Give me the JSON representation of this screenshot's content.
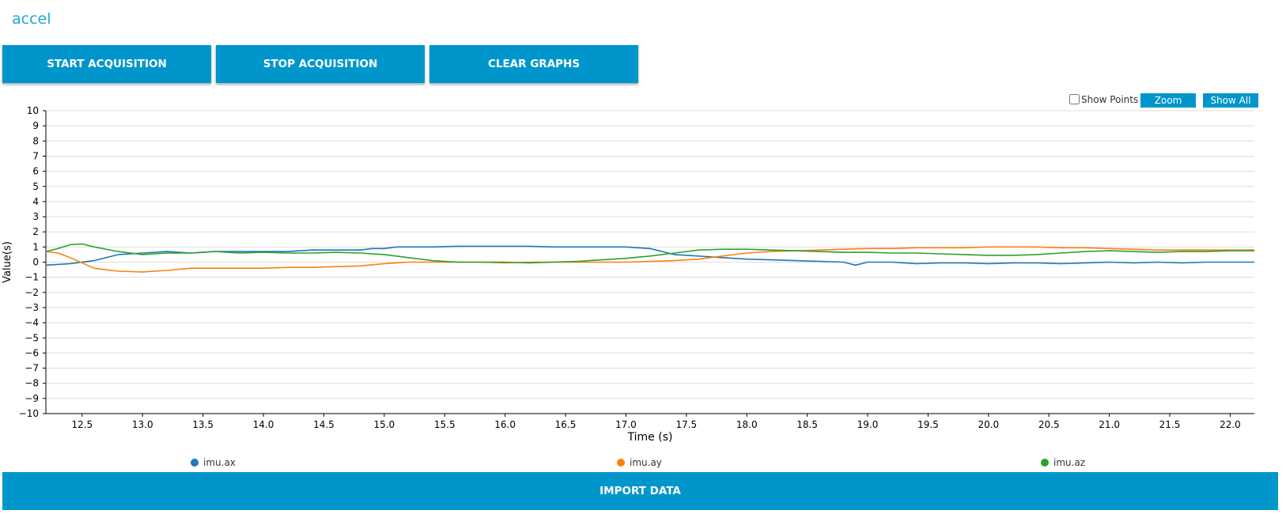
{
  "app": {
    "title": "accel"
  },
  "buttons": {
    "start": "START ACQUISITION",
    "stop": "STOP ACQUISITION",
    "clear": "CLEAR GRAPHS",
    "import": "IMPORT DATA",
    "color": "#0096cc"
  },
  "graph_controls": {
    "show_points_label": "Show Points",
    "show_points_checked": false,
    "zoom_label": "Zoom",
    "show_all_label": "Show All"
  },
  "chart_data": {
    "type": "line",
    "xlabel": "Time (s)",
    "ylabel": "Value(s)",
    "xlim": [
      12.2,
      22.2
    ],
    "ylim": [
      -10,
      10
    ],
    "xticks": [
      12.5,
      13.0,
      13.5,
      14.0,
      14.5,
      15.0,
      15.5,
      16.0,
      16.5,
      17.0,
      17.5,
      18.0,
      18.5,
      19.0,
      19.5,
      20.0,
      20.5,
      21.0,
      21.5,
      22.0
    ],
    "xtick_labels": [
      "12.5",
      "13.0",
      "13.5",
      "14.0",
      "14.5",
      "15.0",
      "15.5",
      "16.0",
      "16.5",
      "17.0",
      "17.5",
      "18.0",
      "18.5",
      "19.0",
      "19.5",
      "20.0",
      "20.5",
      "21.0",
      "21.5",
      "22.0"
    ],
    "yticks": [
      10,
      9,
      8,
      7,
      6,
      5,
      4,
      3,
      2,
      1,
      0,
      -1,
      -2,
      -3,
      -4,
      -5,
      -6,
      -7,
      -8,
      -9,
      -10
    ],
    "ytick_labels": [
      "10",
      "9",
      "8",
      "7",
      "6",
      "5",
      "4",
      "3",
      "2",
      "1",
      "0",
      "−1",
      "−2",
      "−3",
      "−4",
      "−5",
      "−6",
      "−7",
      "−8",
      "−9",
      "−10"
    ],
    "grid": true,
    "legend_position": "bottom",
    "series": [
      {
        "name": "imu.ax",
        "color": "#1f77b4",
        "x": [
          12.2,
          12.4,
          12.6,
          12.8,
          13.0,
          13.2,
          13.4,
          13.6,
          13.8,
          14.0,
          14.2,
          14.4,
          14.6,
          14.8,
          14.9,
          15.0,
          15.1,
          15.2,
          15.4,
          15.6,
          15.8,
          16.0,
          16.2,
          16.4,
          16.6,
          16.8,
          17.0,
          17.2,
          17.4,
          17.6,
          17.8,
          18.0,
          18.2,
          18.4,
          18.6,
          18.8,
          18.9,
          19.0,
          19.2,
          19.4,
          19.6,
          19.8,
          20.0,
          20.2,
          20.4,
          20.6,
          20.8,
          21.0,
          21.2,
          21.4,
          21.6,
          21.8,
          22.0,
          22.2
        ],
        "y": [
          -0.2,
          -0.1,
          0.1,
          0.5,
          0.6,
          0.7,
          0.6,
          0.7,
          0.7,
          0.7,
          0.7,
          0.8,
          0.8,
          0.8,
          0.9,
          0.9,
          1.0,
          1.0,
          1.0,
          1.05,
          1.05,
          1.05,
          1.05,
          1.0,
          1.0,
          1.0,
          1.0,
          0.9,
          0.5,
          0.4,
          0.3,
          0.2,
          0.15,
          0.1,
          0.05,
          0.0,
          -0.2,
          0.0,
          0.0,
          -0.1,
          -0.05,
          -0.05,
          -0.1,
          -0.05,
          -0.05,
          -0.1,
          -0.05,
          0.0,
          -0.05,
          0.0,
          -0.05,
          0.0,
          0.0,
          0.0
        ]
      },
      {
        "name": "imu.ay",
        "color": "#ff7f0e",
        "x": [
          12.2,
          12.3,
          12.4,
          12.6,
          12.8,
          13.0,
          13.2,
          13.4,
          13.6,
          13.8,
          14.0,
          14.2,
          14.4,
          14.6,
          14.8,
          15.0,
          15.2,
          15.4,
          15.6,
          15.8,
          16.0,
          16.2,
          16.4,
          16.6,
          16.8,
          17.0,
          17.2,
          17.4,
          17.6,
          17.8,
          18.0,
          18.2,
          18.4,
          18.6,
          18.8,
          19.0,
          19.2,
          19.4,
          19.6,
          19.8,
          20.0,
          20.2,
          20.4,
          20.6,
          20.8,
          21.0,
          21.2,
          21.4,
          21.6,
          21.8,
          22.0,
          22.2
        ],
        "y": [
          0.7,
          0.6,
          0.3,
          -0.4,
          -0.6,
          -0.65,
          -0.55,
          -0.4,
          -0.4,
          -0.4,
          -0.4,
          -0.35,
          -0.35,
          -0.3,
          -0.25,
          -0.1,
          0.0,
          0.0,
          0.0,
          0.0,
          -0.05,
          0.0,
          0.0,
          0.0,
          0.0,
          0.0,
          0.05,
          0.1,
          0.2,
          0.4,
          0.6,
          0.7,
          0.75,
          0.8,
          0.85,
          0.9,
          0.9,
          0.95,
          0.95,
          0.95,
          1.0,
          1.0,
          1.0,
          0.95,
          0.95,
          0.9,
          0.85,
          0.8,
          0.8,
          0.8,
          0.8,
          0.8
        ]
      },
      {
        "name": "imu.az",
        "color": "#2ca02c",
        "x": [
          12.2,
          12.3,
          12.4,
          12.5,
          12.6,
          12.8,
          13.0,
          13.2,
          13.4,
          13.6,
          13.8,
          14.0,
          14.2,
          14.4,
          14.6,
          14.8,
          15.0,
          15.2,
          15.4,
          15.6,
          15.8,
          16.0,
          16.2,
          16.4,
          16.6,
          16.8,
          17.0,
          17.2,
          17.4,
          17.6,
          17.8,
          18.0,
          18.2,
          18.4,
          18.6,
          18.8,
          19.0,
          19.2,
          19.4,
          19.6,
          19.8,
          20.0,
          20.2,
          20.4,
          20.6,
          20.8,
          21.0,
          21.2,
          21.4,
          21.6,
          21.8,
          22.0,
          22.2
        ],
        "y": [
          0.7,
          0.9,
          1.15,
          1.2,
          1.0,
          0.7,
          0.5,
          0.6,
          0.6,
          0.7,
          0.6,
          0.65,
          0.6,
          0.6,
          0.65,
          0.6,
          0.5,
          0.3,
          0.1,
          0.0,
          0.0,
          0.0,
          -0.05,
          0.0,
          0.05,
          0.15,
          0.25,
          0.4,
          0.6,
          0.8,
          0.85,
          0.85,
          0.8,
          0.75,
          0.7,
          0.65,
          0.65,
          0.6,
          0.6,
          0.55,
          0.5,
          0.45,
          0.45,
          0.5,
          0.6,
          0.7,
          0.75,
          0.7,
          0.65,
          0.7,
          0.7,
          0.75,
          0.75
        ]
      }
    ]
  }
}
